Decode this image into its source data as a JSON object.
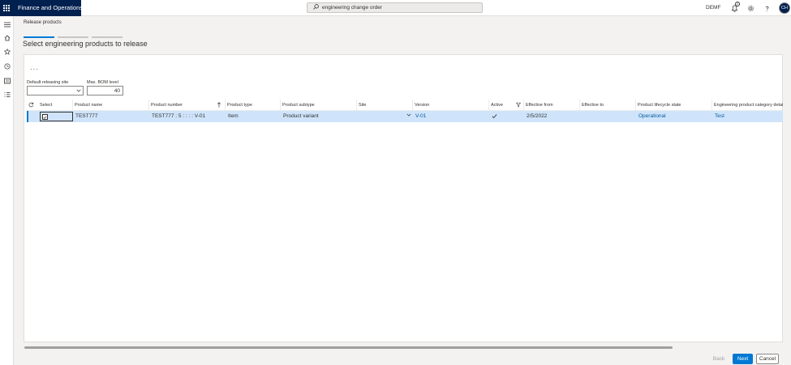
{
  "app": {
    "title": "Finance and Operations",
    "company": "DEMF",
    "user_initials": "CH",
    "notification_count": "1"
  },
  "search": {
    "value": "engineering change order"
  },
  "action_pane": {
    "label": "Release products"
  },
  "page": {
    "title": "Select engineering products to release",
    "wizard_steps": 3,
    "active_step": 1
  },
  "fields": {
    "site_label": "Default releasing site",
    "site_value": "",
    "bom_label": "Max. BOM level",
    "bom_value": "40"
  },
  "grid": {
    "columns": [
      "Select",
      "Product name",
      "Product number",
      "Product type",
      "Product subtype",
      "Site",
      "Version",
      "Active",
      "Effective from",
      "Effective to",
      "Product lifecycle state",
      "Engineering product category details"
    ],
    "rows": [
      {
        "selected": true,
        "product_name": "TEST777",
        "product_number": "TEST777 : 5 : : : : V-01",
        "product_type": "Item",
        "product_subtype": "Product variant",
        "site": "",
        "version": "V-01",
        "active": true,
        "effective_from": "2/5/2022",
        "effective_to": "",
        "lifecycle_state": "Operational",
        "category_details": "Test"
      }
    ]
  },
  "footer": {
    "back_label": "Back",
    "next_label": "Next",
    "cancel_label": "Cancel"
  },
  "colors": {
    "brand": "#002050",
    "accent": "#0078d4",
    "selected_row": "#cfe4fa"
  },
  "icons": [
    "waffle-icon",
    "search-icon",
    "bell-icon",
    "gear-icon",
    "help-icon",
    "hamburger-icon",
    "home-icon",
    "star-icon",
    "clock-icon",
    "workspace-icon",
    "list-icon",
    "refresh-icon",
    "sort-ascending-icon",
    "filter-icon",
    "chevron-down-icon",
    "checkmark-icon"
  ]
}
